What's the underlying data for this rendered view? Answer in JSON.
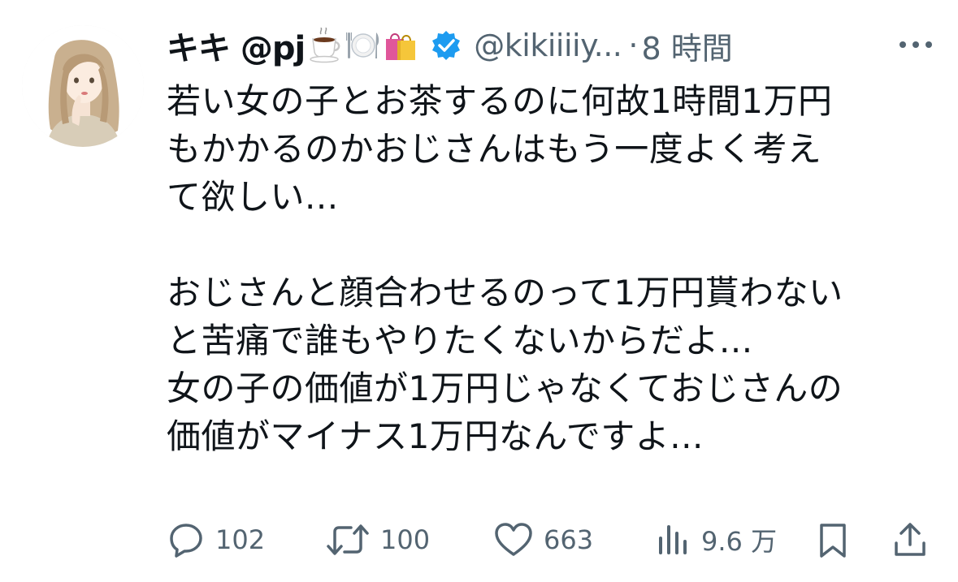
{
  "author": {
    "display_name": "キキ @pj",
    "emojis": [
      "coffee-icon",
      "plate-fork-knife-icon",
      "shopping-bags-icon"
    ],
    "handle": "@kikiiiiy...",
    "separator": "·",
    "time": "8 時間"
  },
  "body": {
    "lines": [
      "若い女の子とお茶するのに何故1時間1万円",
      "もかかるのかおじさんはもう一度よく考え",
      "て欲しい...",
      "",
      "おじさんと顔合わせるのって1万円貰わない",
      "と苦痛で誰もやりたくないからだよ...",
      "女の子の価値が1万円じゃなくておじさんの",
      "価値がマイナス1万円なんですよ..."
    ]
  },
  "actions": {
    "reply": {
      "icon": "reply-icon",
      "count": "102"
    },
    "retweet": {
      "icon": "retweet-icon",
      "count": "100"
    },
    "like": {
      "icon": "heart-icon",
      "count": "663"
    },
    "views": {
      "icon": "views-chart-icon",
      "count": "9.6 万"
    },
    "bookmark": {
      "icon": "bookmark-icon"
    },
    "share": {
      "icon": "share-icon"
    }
  },
  "colors": {
    "text": "#0f1419",
    "muted": "#536471",
    "verified": "#1d9bf0"
  }
}
